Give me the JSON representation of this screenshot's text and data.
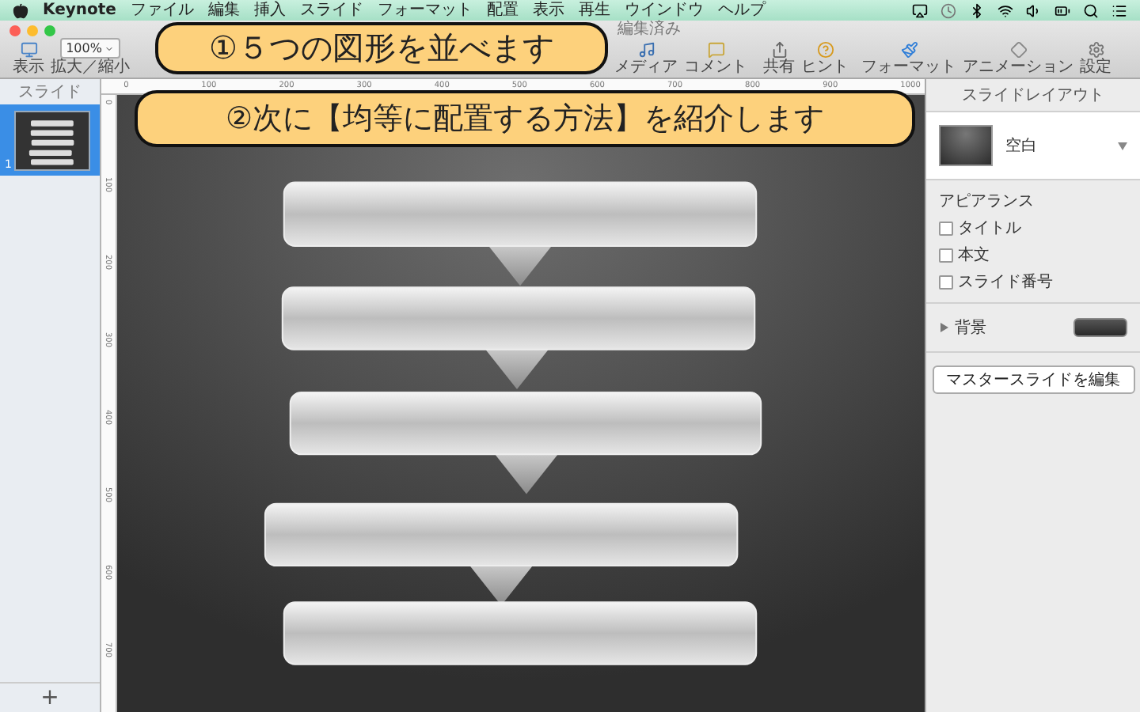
{
  "menu_bar": {
    "app": "Keynote",
    "items": [
      "ファイル",
      "編集",
      "挿入",
      "スライド",
      "フォーマット",
      "配置",
      "表示",
      "再生",
      "ウインドウ",
      "ヘルプ"
    ]
  },
  "toolbar": {
    "document_status": "編集済み",
    "zoom": "100%",
    "items": [
      {
        "kind": "view",
        "label": "表示"
      },
      {
        "kind": "zoom",
        "label": "拡大／縮小"
      },
      {
        "kind": "media",
        "label": "メディア"
      },
      {
        "kind": "comment",
        "label": "コメント"
      },
      {
        "kind": "share",
        "label": "共有"
      },
      {
        "kind": "tips",
        "label": "ヒント"
      },
      {
        "kind": "format",
        "label": "フォーマット"
      },
      {
        "kind": "animate",
        "label": "アニメーション"
      },
      {
        "kind": "settings",
        "label": "設定"
      }
    ]
  },
  "sidebar": {
    "title": "スライド",
    "slides": [
      {
        "number": "1",
        "selected": true
      }
    ],
    "add_button": "+"
  },
  "rulers": {
    "horizontal": [
      "0",
      "100",
      "200",
      "300",
      "400",
      "500",
      "600",
      "700",
      "800",
      "900",
      "1000"
    ],
    "vertical": [
      "0",
      "100",
      "200",
      "300",
      "400",
      "500",
      "600",
      "700"
    ]
  },
  "inspector": {
    "title": "スライドレイアウト",
    "layout": "空白",
    "appearance_title": "アピアランス",
    "options": [
      {
        "label": "タイトル",
        "checked": false
      },
      {
        "label": "本文",
        "checked": false
      },
      {
        "label": "スライド番号",
        "checked": false
      }
    ],
    "background": {
      "label": "背景",
      "expanded": false
    },
    "edit_master_button": "マスタースライドを編集"
  },
  "callouts": [
    {
      "text": "①５つの図形を並べます"
    },
    {
      "text": "②次に【均等に配置する方法】を紹介します"
    }
  ]
}
